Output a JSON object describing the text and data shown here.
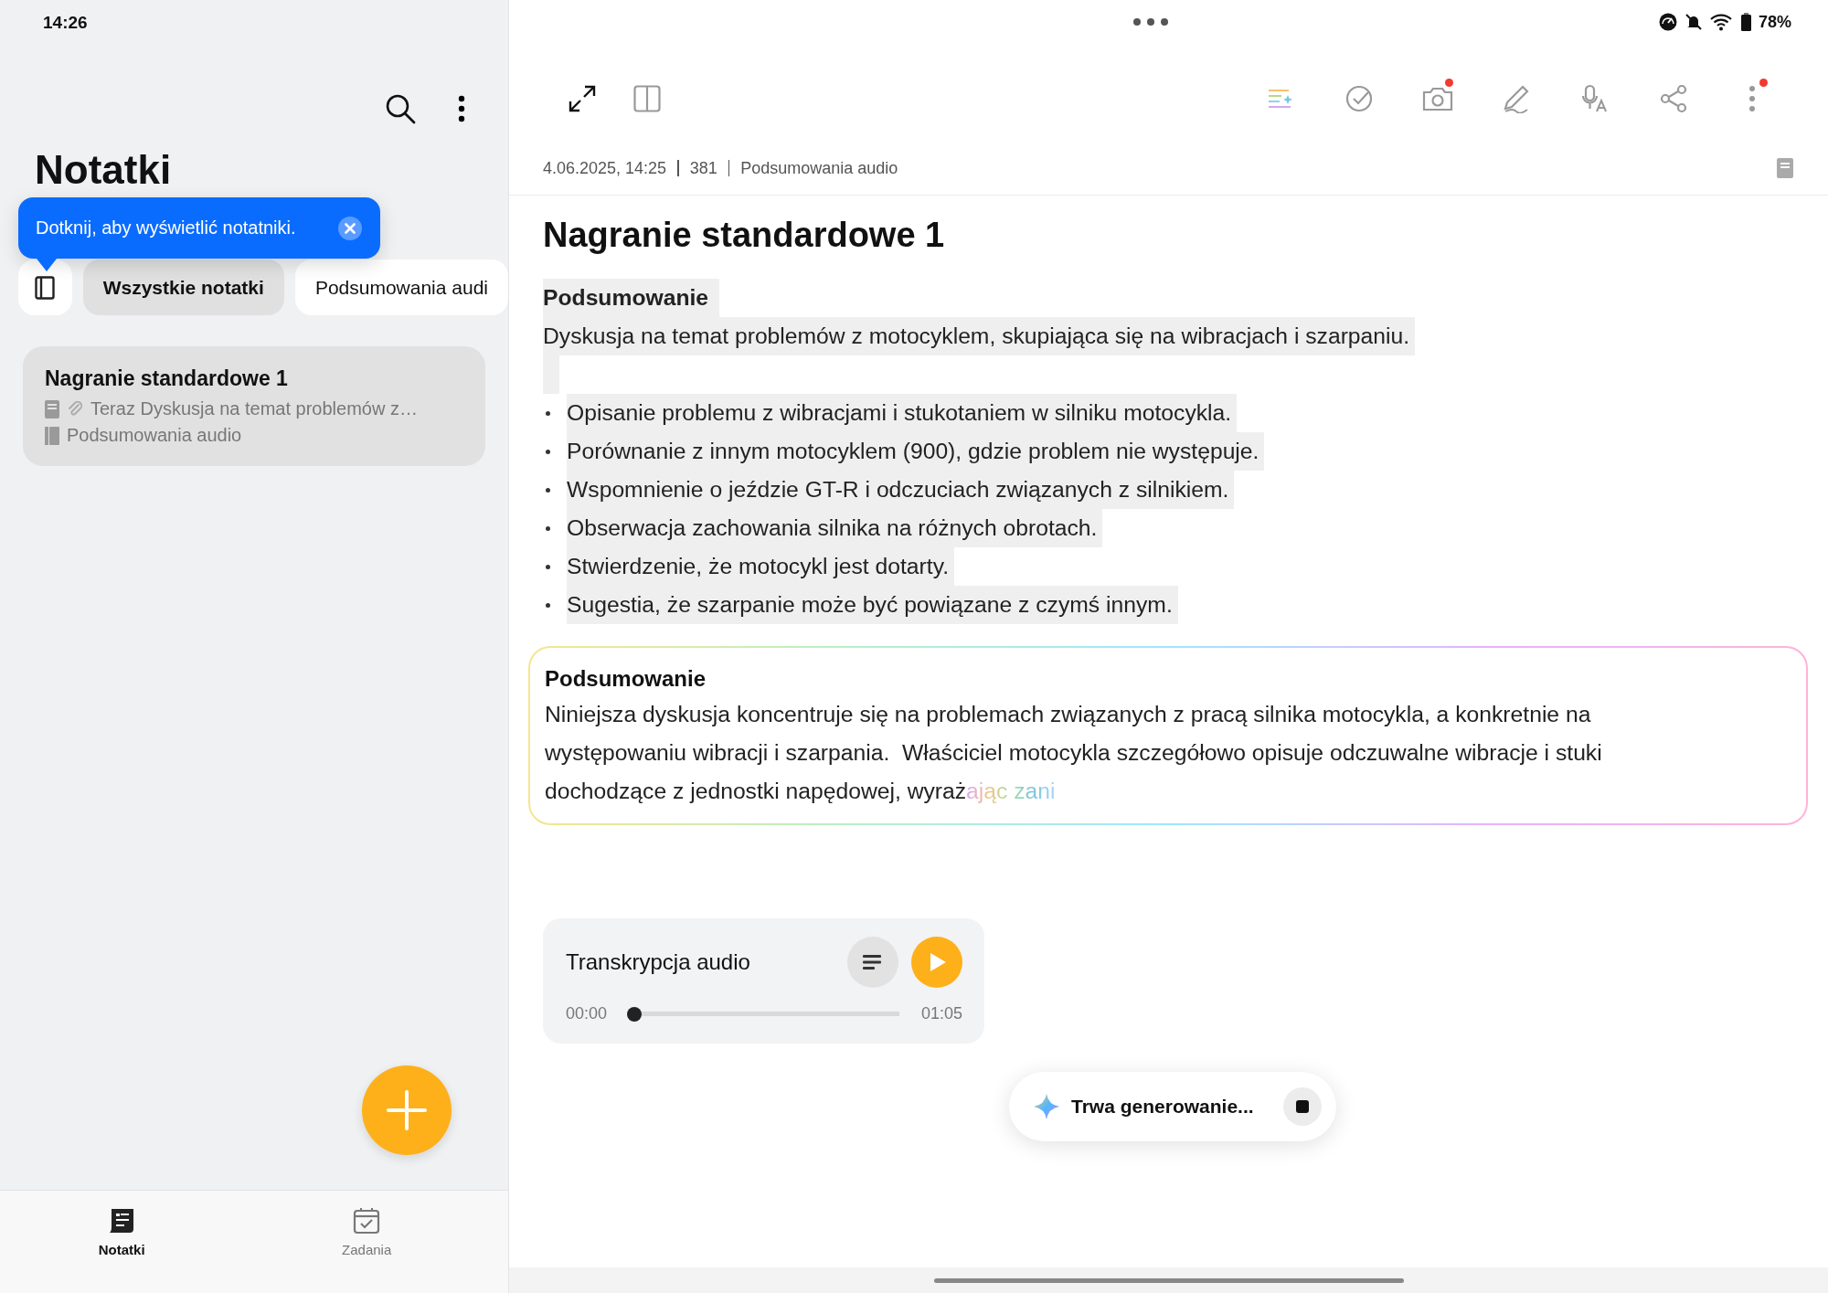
{
  "status_bar": {
    "time": "14:26",
    "battery": "78%"
  },
  "sidebar": {
    "title": "Notatki",
    "tooltip": "Dotknij, aby wyświetlić notatniki.",
    "chips": [
      {
        "label": "Wszystkie notatki",
        "selected": true
      },
      {
        "label": "Podsumowania audi",
        "selected": false
      }
    ],
    "notes": [
      {
        "title": "Nagranie standardowe 1",
        "preview": "Teraz Dyskusja na temat problemów z…",
        "notebook": "Podsumowania audio",
        "selected": true
      }
    ]
  },
  "bottom_nav": [
    {
      "label": "Notatki",
      "kind": "notes",
      "selected": true
    },
    {
      "label": "Zadania",
      "kind": "tasks",
      "selected": false
    }
  ],
  "toolbar": [
    {
      "kind": "ai-format",
      "badge": false
    },
    {
      "kind": "check",
      "badge": false
    },
    {
      "kind": "camera",
      "badge": true
    },
    {
      "kind": "pen",
      "badge": false
    },
    {
      "kind": "voice",
      "badge": false
    },
    {
      "kind": "share",
      "badge": false
    },
    {
      "kind": "more",
      "badge": true
    }
  ],
  "note": {
    "date": "4.06.2025, 14:25",
    "count": "381",
    "notebook": "Podsumowania audio",
    "title": "Nagranie standardowe 1",
    "summary": {
      "heading": "Podsumowanie",
      "paragraph": "Dyskusja na temat problemów z motocyklem, skupiająca się na wibracjach i szarpaniu.",
      "bullets": [
        "Opisanie problemu z wibracjami i stukotaniem w silniku motocykla.",
        "Porównanie z innym motocyklem (900), gdzie problem nie występuje.",
        "Wspomnienie o jeździe GT-R i odczuciach związanych z silnikiem.",
        "Obserwacja zachowania silnika na różnych obrotach.",
        "Stwierdzenie, że motocykl jest dotarty.",
        "Sugestia, że szarpanie może być powiązane z czymś innym."
      ]
    },
    "ai_summary": {
      "heading": "Podsumowanie",
      "text": "Niniejsza dyskusja koncentruje się na problemach związanych z pracą silnika motocykla, a konkretnie na występowaniu wibracji i szarpania.  Właściciel motocykla szczegółowo opisuje odczuwalne wibracje i stuki dochodzące z jednostki napędowej, wyraż",
      "generating_tail": "ając zani"
    }
  },
  "audio": {
    "title": "Transkrypcja audio",
    "start": "00:00",
    "end": "01:05",
    "level": 0
  },
  "generating": {
    "text": "Trwa generowanie..."
  }
}
